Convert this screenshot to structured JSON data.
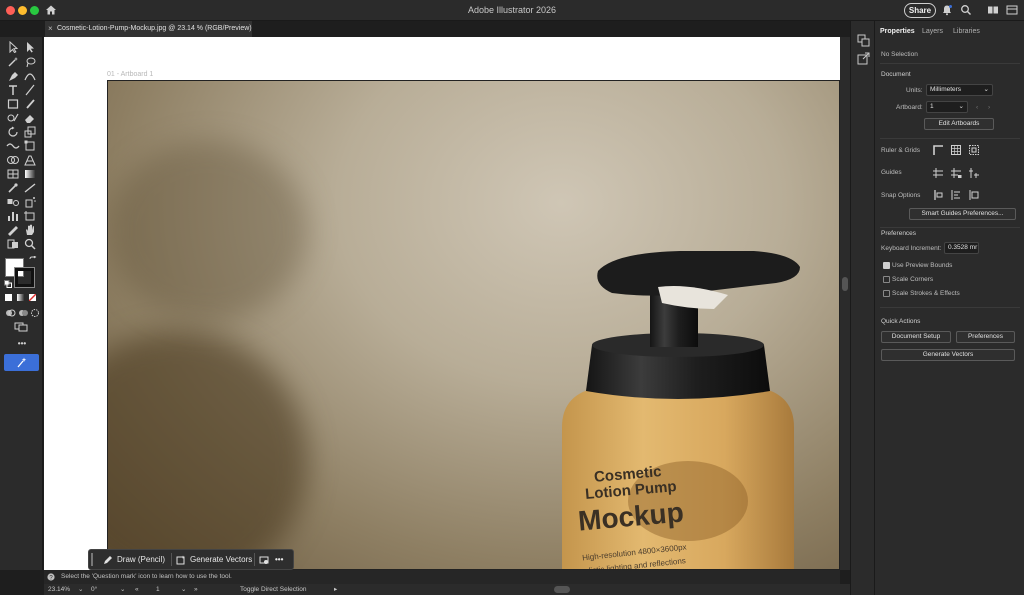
{
  "app": {
    "title": "Adobe Illustrator 2026",
    "share_label": "Share"
  },
  "document": {
    "tab_label": "Cosmetic-Lotion-Pump-Mockup.jpg @ 23.14 % (RGB/Preview)",
    "close_glyph": "×",
    "artboard_label": "01 - Artboard 1"
  },
  "mockup": {
    "line1": "Cosmetic",
    "line2": "Lotion Pump",
    "line3": "Mockup",
    "line4": "High-resolution 4800×3600px",
    "line5": "Realistic lighting and reflections"
  },
  "panel": {
    "tabs": [
      "Properties",
      "Layers",
      "Libraries"
    ],
    "no_selection": "No Selection",
    "document_heading": "Document",
    "units_label": "Units:",
    "units_value": "Millimeters",
    "artboard_label": "Artboard:",
    "artboard_value": "1",
    "edit_artboards": "Edit Artboards",
    "ruler_grids": "Ruler & Grids",
    "guides": "Guides",
    "snap_options": "Snap Options",
    "smart_guides_prefs": "Smart Guides Preferences...",
    "preferences_heading": "Preferences",
    "keyboard_increment_label": "Keyboard Increment:",
    "keyboard_increment_value": "0.3528 mr",
    "use_preview_bounds": "Use Preview Bounds",
    "scale_corners": "Scale Corners",
    "scale_strokes": "Scale Strokes & Effects",
    "quick_actions_heading": "Quick Actions",
    "document_setup": "Document Setup",
    "preferences_btn": "Preferences",
    "generate_vectors": "Generate Vectors",
    "checkbox_states": {
      "use_preview_bounds": true,
      "scale_corners": false,
      "scale_strokes": false
    }
  },
  "context_bar": {
    "draw_pencil": "Draw (Pencil)",
    "generate_vectors": "Generate Vectors",
    "more": "•••"
  },
  "hint": "Select the 'Question mark' icon to learn how to use the tool.",
  "status": {
    "zoom": "23.14%",
    "rotation": "0°",
    "artboard": "1",
    "tool": "Toggle Direct Selection"
  },
  "toolbar_more": "•••",
  "colors": {
    "accent": "#3b6fd8",
    "panel_bg": "#2b2b2b",
    "canvas_bg": "#ffffff"
  }
}
